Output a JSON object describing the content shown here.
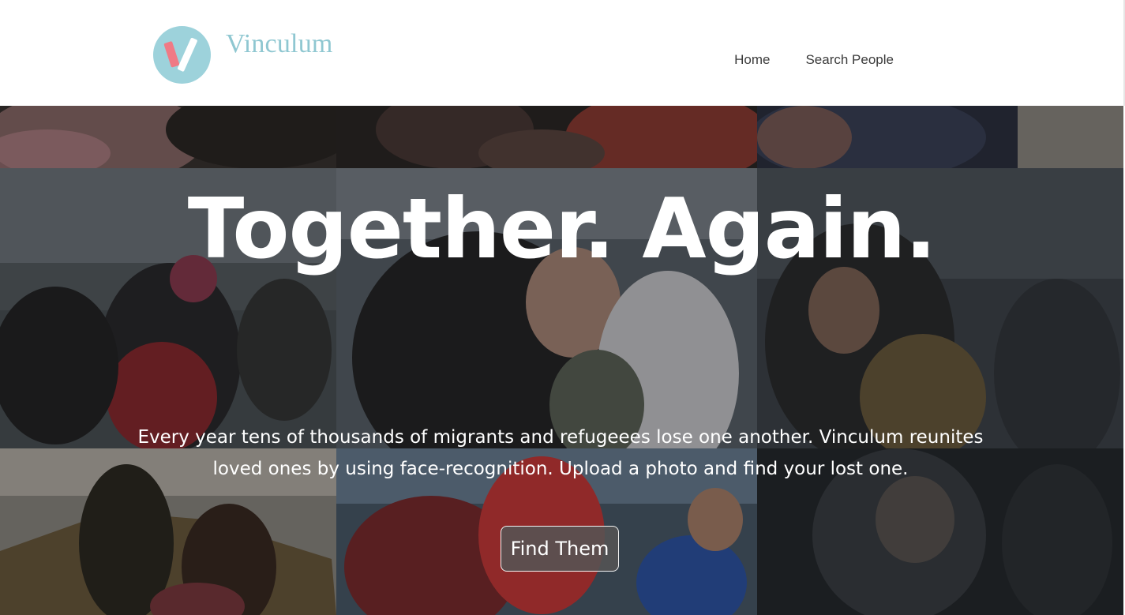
{
  "brand": {
    "name": "Vinculum",
    "logo_icon": "v-logo-icon",
    "logo_colors": {
      "circle": "#9dd2db",
      "stroke": "#f07a85"
    }
  },
  "nav": {
    "items": [
      {
        "label": "Home"
      },
      {
        "label": "Search People"
      }
    ]
  },
  "hero": {
    "title": "Together. Again.",
    "description": "Every year tens of thousands of migrants and refugeees lose one another. Vinculum reunites loved ones by using face-recognition. Upload a photo and find your lost one.",
    "cta_label": "Find Them",
    "photos": [
      "photo-top-left",
      "photo-top-center",
      "photo-top-right",
      "photo-middle-left",
      "photo-middle-center",
      "photo-middle-right",
      "photo-bottom-left",
      "photo-bottom-center",
      "photo-bottom-right"
    ]
  },
  "colors": {
    "brand_text": "#8fc7d1",
    "nav_text": "#3b3b3b",
    "hero_text": "#ffffff",
    "button_bg": "#555555"
  }
}
